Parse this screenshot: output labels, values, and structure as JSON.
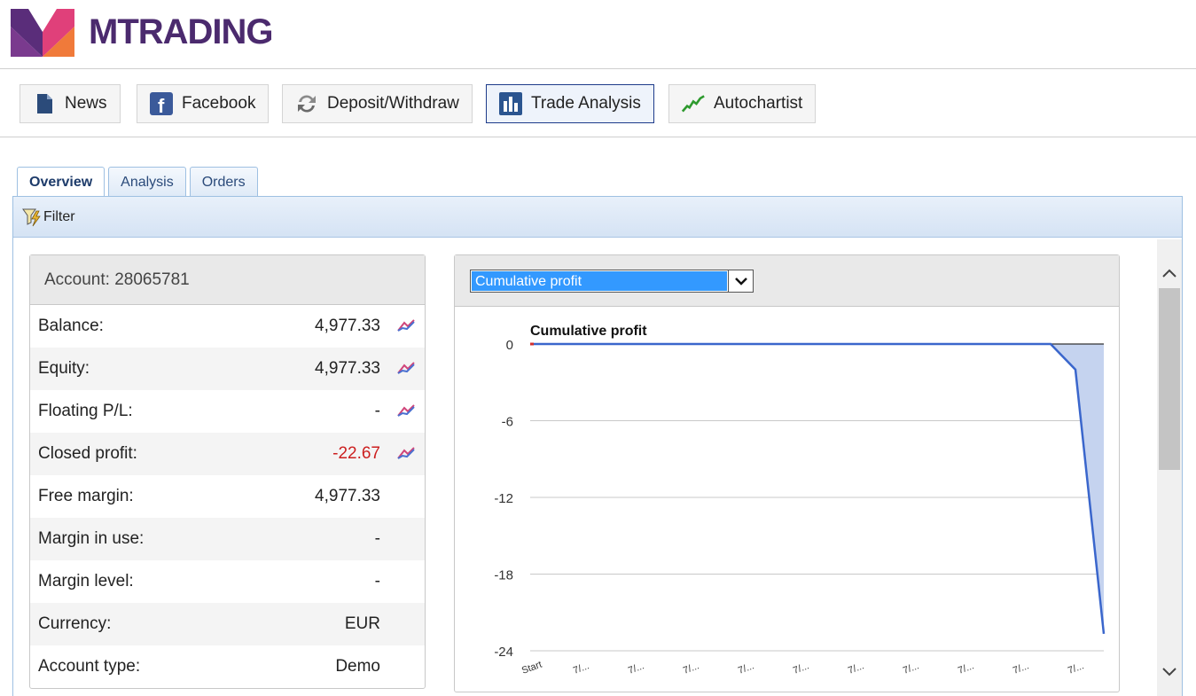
{
  "brand": {
    "name": "MTRADING",
    "text_color": "#4b2a6e",
    "mark_colors": [
      "#e0407a",
      "#f07a3a",
      "#5a2d7a"
    ]
  },
  "toolbar": {
    "buttons": [
      {
        "label": "News",
        "icon": "document-icon"
      },
      {
        "label": "Facebook",
        "icon": "facebook-icon"
      },
      {
        "label": "Deposit/Withdraw",
        "icon": "refresh-arrows-icon"
      },
      {
        "label": "Trade Analysis",
        "icon": "bar-chart-icon",
        "active": true
      },
      {
        "label": "Autochartist",
        "icon": "line-chart-icon"
      }
    ]
  },
  "tabs": [
    {
      "label": "Overview",
      "active": true
    },
    {
      "label": "Analysis"
    },
    {
      "label": "Orders"
    }
  ],
  "filter": {
    "label": "Filter",
    "icon": "funnel-lightning-icon"
  },
  "account": {
    "header": "Account: 28065781",
    "rows": [
      {
        "label": "Balance:",
        "value": "4,977.33",
        "has_chart_icon": true
      },
      {
        "label": "Equity:",
        "value": "4,977.33",
        "has_chart_icon": true
      },
      {
        "label": "Floating P/L:",
        "value": "-",
        "has_chart_icon": true
      },
      {
        "label": "Closed profit:",
        "value": "-22.67",
        "has_chart_icon": true,
        "negative": true
      },
      {
        "label": "Free margin:",
        "value": "4,977.33"
      },
      {
        "label": "Margin in use:",
        "value": "-"
      },
      {
        "label": "Margin level:",
        "value": "-"
      },
      {
        "label": "Currency:",
        "value": "EUR"
      },
      {
        "label": "Account type:",
        "value": "Demo"
      }
    ],
    "negative_color": "#cc1f1f"
  },
  "chart_select": {
    "selected": "Cumulative profit"
  },
  "chart_data": {
    "type": "area",
    "title": "Cumulative profit",
    "x": [
      "Start",
      "7/...",
      "7/...",
      "7/...",
      "7/...",
      "7/...",
      "7/...",
      "7/...",
      "7/...",
      "7/...",
      "7/..."
    ],
    "values": [
      0,
      0,
      0,
      0,
      0,
      0,
      0,
      0,
      0,
      0,
      -2,
      -22.67
    ],
    "x_tick_labels": [
      "Start",
      "7/...",
      "7/...",
      "7/...",
      "7/...",
      "7/...",
      "7/...",
      "7/...",
      "7/...",
      "7/...",
      "7/..."
    ],
    "y_ticks": [
      0,
      -6,
      -12,
      -18,
      -24
    ],
    "ylim": [
      -24,
      0
    ],
    "grid": true,
    "line_color": "#3a66cc",
    "fill_color": "#c5d3ef"
  },
  "scrollbar": {
    "up_icon": "chevron-up-icon",
    "down_icon": "chevron-down-icon"
  }
}
